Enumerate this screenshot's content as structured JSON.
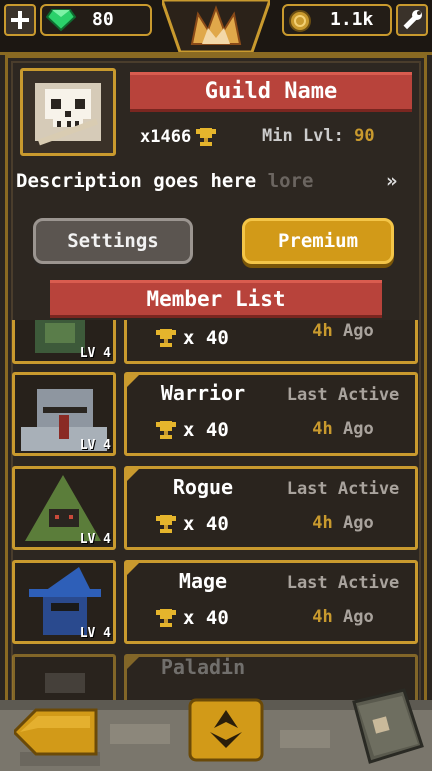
{
  "topbar": {
    "gems": "80",
    "coins": "1.1k"
  },
  "guild": {
    "name": "Guild Name",
    "trophy_count": "x1466",
    "min_level_label": "Min Lvl:",
    "min_level_value": "90",
    "description": "Description goes here ",
    "description_fade": "lore",
    "expand_glyph": "»"
  },
  "buttons": {
    "settings": "Settings",
    "premium": "Premium"
  },
  "member_list": {
    "title": "Member List",
    "last_active_label": "Last Active",
    "members": [
      {
        "name": "",
        "level": "LV 4",
        "trophies": "x 40",
        "ago_num": "4h",
        "ago_word": "Ago",
        "avatar": "goblin-avatar"
      },
      {
        "name": "Warrior",
        "level": "LV 4",
        "trophies": "x 40",
        "ago_num": "4h",
        "ago_word": "Ago",
        "avatar": "knight-avatar"
      },
      {
        "name": "Rogue",
        "level": "LV 4",
        "trophies": "x 40",
        "ago_num": "4h",
        "ago_word": "Ago",
        "avatar": "hooded-avatar"
      },
      {
        "name": "Mage",
        "level": "LV 4",
        "trophies": "x 40",
        "ago_num": "4h",
        "ago_word": "Ago",
        "avatar": "wizard-avatar"
      },
      {
        "name": "Paladin",
        "level": "",
        "trophies": "",
        "ago_num": "",
        "ago_word": "",
        "avatar": "paladin-avatar"
      }
    ]
  },
  "colors": {
    "gold": "#c99a2e",
    "ribbon": "#b8433b",
    "premium": "#d29a18",
    "panel": "#2d2721"
  }
}
